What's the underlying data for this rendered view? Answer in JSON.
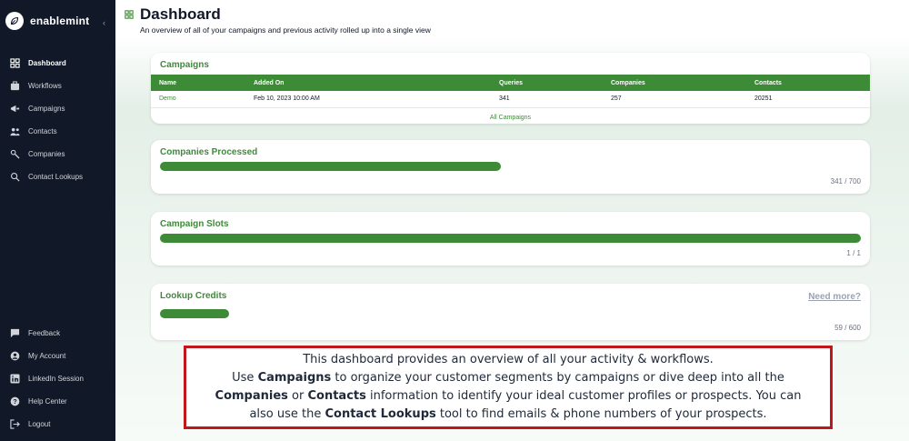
{
  "app": {
    "brand_name": "enablemint"
  },
  "sidebar": {
    "items": [
      {
        "label": "Dashboard",
        "icon": "dashboard-icon",
        "active": true
      },
      {
        "label": "Workflows",
        "icon": "workflows-icon"
      },
      {
        "label": "Campaigns",
        "icon": "megaphone-icon"
      },
      {
        "label": "Contacts",
        "icon": "users-icon"
      },
      {
        "label": "Companies",
        "icon": "companies-icon"
      },
      {
        "label": "Contact Lookups",
        "icon": "search-icon"
      }
    ],
    "bottom_items": [
      {
        "label": "Feedback",
        "icon": "feedback-icon"
      },
      {
        "label": "My Account",
        "icon": "account-icon"
      },
      {
        "label": "LinkedIn Session",
        "icon": "linkedin-icon"
      },
      {
        "label": "Help Center",
        "icon": "help-icon"
      },
      {
        "label": "Logout",
        "icon": "logout-icon"
      }
    ]
  },
  "header": {
    "title": "Dashboard",
    "subtitle": "An overview of all of your campaigns and previous activity rolled up into a single view"
  },
  "campaigns_card": {
    "title": "Campaigns",
    "columns": [
      "Name",
      "Added On",
      "Queries",
      "Companies",
      "Contacts"
    ],
    "rows": [
      {
        "name": "Demo",
        "added_on": "Feb 10, 2023 10:00 AM",
        "queries": "341",
        "companies": "257",
        "contacts": "20251"
      }
    ],
    "all_link": "All Campaigns"
  },
  "companies_processed": {
    "title": "Companies Processed",
    "count_text": "341 / 700",
    "fraction": 0.487
  },
  "campaign_slots": {
    "title": "Campaign Slots",
    "count_text": "1 / 1",
    "fraction": 1.0
  },
  "lookup_credits": {
    "title": "Lookup Credits",
    "count_text": "59 / 600",
    "fraction": 0.098,
    "need_more": "Need more?"
  },
  "callout": {
    "line1": "This dashboard provides an overview of all your activity & workflows.",
    "line2_a": "Use ",
    "line2_b": "Campaigns",
    "line2_c": " to organize your customer segments by campaigns or dive deep into all the",
    "line3_a": "Companies",
    "line3_b": " or ",
    "line3_c": "Contacts",
    "line3_d": " information to identify your ideal customer profiles or prospects. You can",
    "line4_a": "also use the ",
    "line4_b": "Contact Lookups",
    "line4_c": " tool to find emails & phone numbers of your prospects."
  },
  "colors": {
    "sidebar_bg": "#111827",
    "accent_green": "#3d8b37",
    "callout_border": "#c0161c"
  }
}
